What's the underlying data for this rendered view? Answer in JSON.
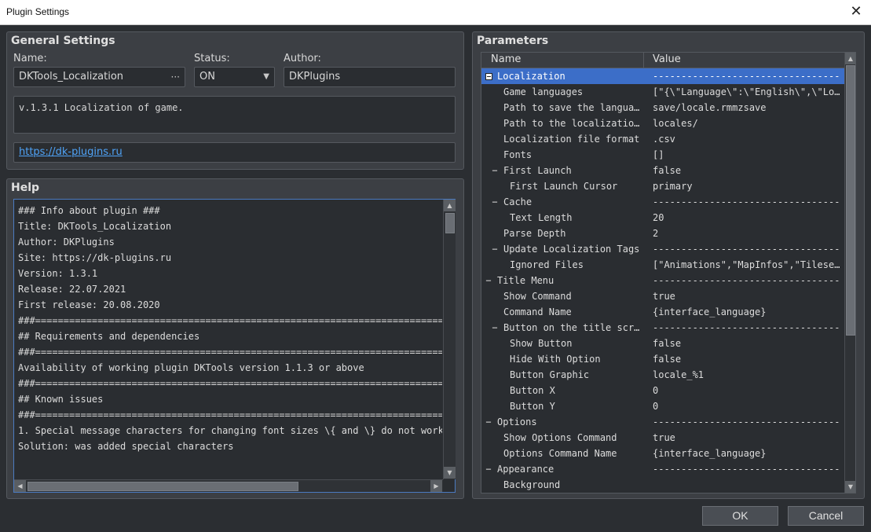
{
  "window": {
    "title": "Plugin Settings",
    "close_glyph": "✕"
  },
  "general": {
    "title": "General Settings",
    "name_label": "Name:",
    "name_value": "DKTools_Localization",
    "name_dots": "···",
    "status_label": "Status:",
    "status_value": "ON",
    "author_label": "Author:",
    "author_value": "DKPlugins",
    "description": "v.1.3.1 Localization of game.",
    "url": "https://dk-plugins.ru"
  },
  "help": {
    "title": "Help",
    "lines": [
      "### Info about plugin ###",
      "Title: DKTools_Localization",
      "Author: DKPlugins",
      "Site: https://dk-plugins.ru",
      "Version: 1.3.1",
      "Release: 22.07.2021",
      "First release: 20.08.2020",
      "",
      "###==============================================================================",
      "## Requirements and dependencies",
      "###==============================================================================",
      "Availability of working plugin DKTools version 1.1.3 or above",
      "",
      "###==============================================================================",
      "## Known issues",
      "###==============================================================================",
      "1. Special message characters for changing font sizes \\{ and \\} do not work",
      "Solution: was added special characters"
    ]
  },
  "parameters": {
    "title": "Parameters",
    "col_name": "Name",
    "col_value": "Value",
    "rows": [
      {
        "name": "Localization",
        "value": "------------------------------------",
        "level": 0,
        "exp": "box",
        "sel": true
      },
      {
        "name": "Game languages",
        "value": "[\"{\\\"Language\\\":\\\"English\\\",\\\"Lo…",
        "level": 1
      },
      {
        "name": "Path to save the langua…",
        "value": "save/locale.rmmzsave",
        "level": 1
      },
      {
        "name": "Path to the localizatio…",
        "value": "locales/",
        "level": 1
      },
      {
        "name": "Localization file format",
        "value": ".csv",
        "level": 1
      },
      {
        "name": "Fonts",
        "value": "[]",
        "level": 1
      },
      {
        "name": "First Launch",
        "value": "false",
        "level": 1,
        "exp": "minus"
      },
      {
        "name": "First Launch Cursor",
        "value": "primary",
        "level": 2
      },
      {
        "name": "Cache",
        "value": "------------------------------------",
        "level": 1,
        "exp": "minus"
      },
      {
        "name": "Text Length",
        "value": "20",
        "level": 2
      },
      {
        "name": "Parse Depth",
        "value": "2",
        "level": 1
      },
      {
        "name": "Update Localization Tags",
        "value": "------------------------------------",
        "level": 1,
        "exp": "minus"
      },
      {
        "name": "Ignored Files",
        "value": "[\"Animations\",\"MapInfos\",\"Tilese…",
        "level": 2
      },
      {
        "name": "Title Menu",
        "value": "------------------------------------",
        "level": 0,
        "exp": "minus"
      },
      {
        "name": "Show Command",
        "value": "true",
        "level": 1
      },
      {
        "name": "Command Name",
        "value": "{interface_language}",
        "level": 1
      },
      {
        "name": "Button on the title scr…",
        "value": "------------------------------------",
        "level": 1,
        "exp": "minus"
      },
      {
        "name": "Show Button",
        "value": "false",
        "level": 2
      },
      {
        "name": "Hide With Option",
        "value": "false",
        "level": 2
      },
      {
        "name": "Button Graphic",
        "value": "locale_%1",
        "level": 2
      },
      {
        "name": "Button X",
        "value": "0",
        "level": 2
      },
      {
        "name": "Button Y",
        "value": "0",
        "level": 2
      },
      {
        "name": "Options",
        "value": "------------------------------------",
        "level": 0,
        "exp": "minus"
      },
      {
        "name": "Show Options Command",
        "value": "true",
        "level": 1
      },
      {
        "name": "Options Command Name",
        "value": "{interface_language}",
        "level": 1
      },
      {
        "name": "Appearance",
        "value": "------------------------------------",
        "level": 0,
        "exp": "minus"
      },
      {
        "name": "Background",
        "value": "",
        "level": 1
      }
    ]
  },
  "buttons": {
    "ok": "OK",
    "cancel": "Cancel"
  },
  "colors": {
    "background": "#2b2e32",
    "panel": "#3c3f44",
    "selection": "#3c6ec8",
    "link": "#4fa3f7"
  }
}
